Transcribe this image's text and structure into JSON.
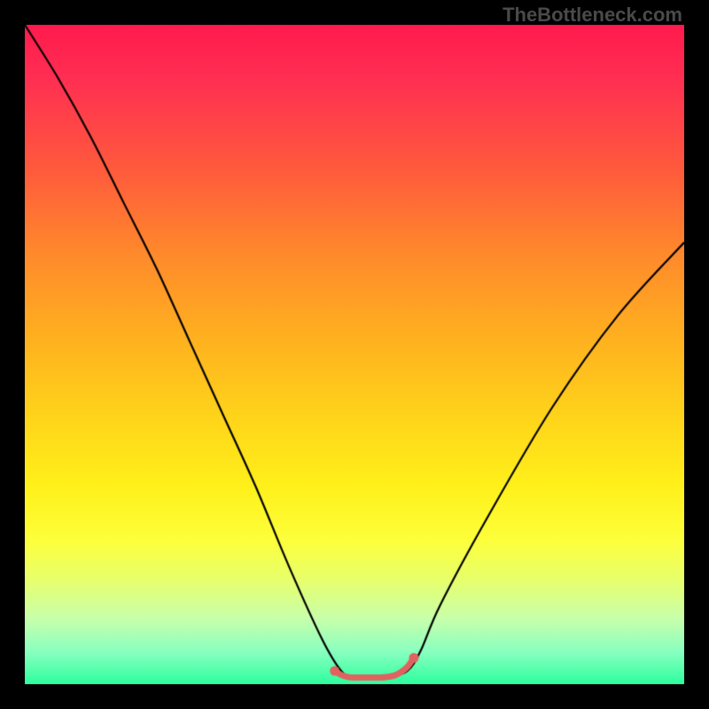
{
  "watermark": "TheBottleneck.com",
  "chart_data": {
    "type": "line",
    "title": "",
    "xlabel": "",
    "ylabel": "",
    "xlim": [
      0,
      100
    ],
    "ylim": [
      0,
      100
    ],
    "grid": false,
    "legend": false,
    "background_gradient": {
      "top": "#ff1a4d",
      "mid": "#ffd51a",
      "bottom": "#2cff9d"
    },
    "series": [
      {
        "name": "bottleneck-curve",
        "color": "#000000",
        "x": [
          0,
          5,
          10,
          15,
          20,
          25,
          30,
          35,
          40,
          45,
          48,
          50,
          52,
          55,
          58,
          60,
          63,
          70,
          80,
          90,
          100
        ],
        "y": [
          100,
          92,
          83,
          73,
          63,
          52,
          41,
          30,
          18,
          7,
          2,
          1,
          1,
          1,
          2,
          5,
          12,
          25,
          42,
          56,
          67
        ]
      },
      {
        "name": "flat-bottom-highlight",
        "color": "#e0635f",
        "thickness": 7,
        "x": [
          47,
          48,
          49,
          50,
          51,
          52,
          53,
          54,
          55,
          56,
          57,
          58,
          59
        ],
        "y": [
          2,
          1.4,
          1.1,
          1.0,
          1.0,
          1.0,
          1.0,
          1.0,
          1.1,
          1.3,
          1.8,
          2.6,
          4.0
        ],
        "endpoints": [
          {
            "x": 47,
            "y": 2
          },
          {
            "x": 59,
            "y": 4.0
          }
        ]
      }
    ]
  }
}
